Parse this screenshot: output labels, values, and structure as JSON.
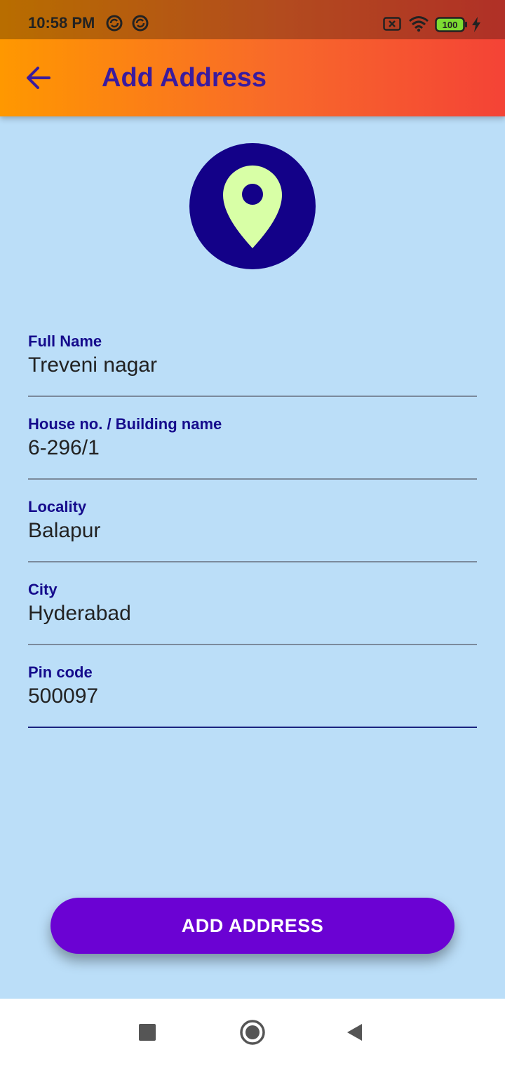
{
  "status_bar": {
    "time": "10:58 PM",
    "battery": "100",
    "icons": [
      "sync-icon",
      "sync-icon",
      "no-sim-icon",
      "wifi-icon",
      "battery-icon",
      "charging-icon"
    ]
  },
  "app_bar": {
    "title": "Add Address",
    "back_icon": "arrow-back-icon"
  },
  "header_icon": "location-pin-icon",
  "form": {
    "full_name": {
      "label": "Full Name",
      "value": "Treveni nagar"
    },
    "house": {
      "label": "House no. / Building name",
      "value": "6-296/1"
    },
    "locality": {
      "label": "Locality",
      "value": "Balapur"
    },
    "city": {
      "label": "City",
      "value": "Hyderabad"
    },
    "pin_code": {
      "label": "Pin code",
      "value": "500097"
    }
  },
  "submit_button": {
    "label": "ADD ADDRESS"
  },
  "nav_bar": {
    "icons": [
      "square-recents-icon",
      "circle-home-icon",
      "triangle-back-icon"
    ]
  },
  "colors": {
    "background": "#bbdef8",
    "gradient_start": "#ff9800",
    "gradient_end": "#f44336",
    "title": "#3a1b9e",
    "label": "#150b8c",
    "button": "#6b02d3",
    "pin_circle": "#130188",
    "pin": "#d8ffa6"
  }
}
